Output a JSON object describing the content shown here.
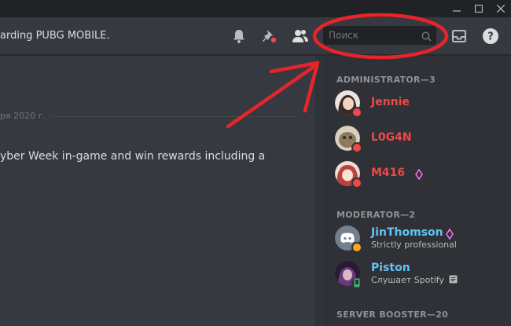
{
  "header": {
    "topic": "arding PUBG MOBILE.",
    "search_placeholder": "Поиск"
  },
  "chat": {
    "date_divider": "ря 2020 г.",
    "message": "yber Week in-game and win rewards including a"
  },
  "members": {
    "categories": [
      {
        "label": "ADMINISTRATOR—3"
      },
      {
        "label": "MODERATOR—2"
      },
      {
        "label": "SERVER BOOSTER—20"
      }
    ],
    "administrators": [
      {
        "name": "Jennie",
        "status": "dnd"
      },
      {
        "name": "L0G4N",
        "status": "dnd"
      },
      {
        "name": "M416",
        "status": "dnd",
        "booster": true
      }
    ],
    "moderators": [
      {
        "name": "JinThomson",
        "custom_status": "Strictly professional",
        "status": "idle",
        "booster": true
      },
      {
        "name": "Piston",
        "custom_status": "Слушает Spotify",
        "status": "mobile"
      }
    ]
  },
  "colors": {
    "admin_role": "#f04747",
    "moderator_role": "#61c3f2",
    "booster": "#ff73fa",
    "annotation": "#e8242b",
    "dnd": "#f04747",
    "idle": "#faa61a",
    "online": "#43b581"
  },
  "icons": [
    "minimize-icon",
    "maximize-icon",
    "close-icon",
    "bell-icon",
    "pin-icon",
    "members-icon",
    "search-icon",
    "inbox-icon",
    "help-icon"
  ]
}
